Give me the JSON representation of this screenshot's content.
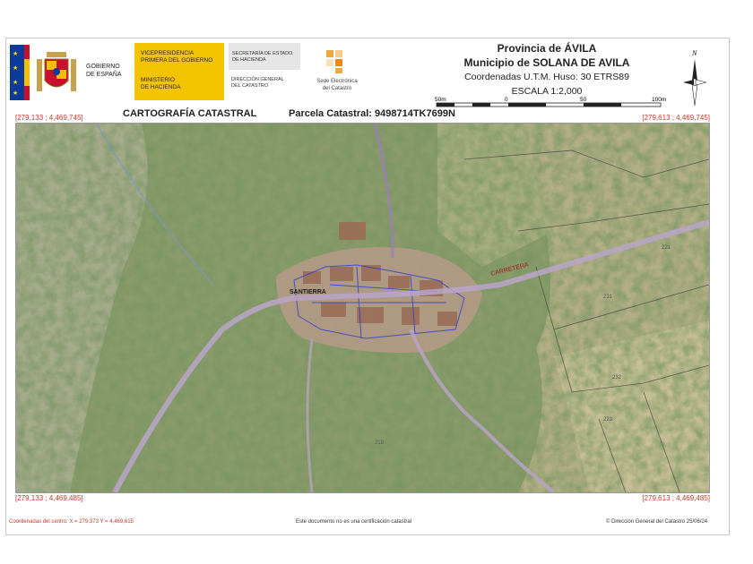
{
  "header": {
    "gob_text": "GOBIERNO\nDE ESPAÑA",
    "vice_text": "VICEPRESIDENCIA\nPRIMERA DEL GOBIERNO",
    "ministerio_text": "MINISTERIO\nDE HACIENDA",
    "secretaria_text": "SECRETARÍA DE ESTADO\nDE HACIENDA",
    "direccion_text": "DIRECCIÓN GENERAL\nDEL CATASTRO",
    "sede_text": "Sede Electrónica\ndel Catastro",
    "provincia": "Provincia de ÁVILA",
    "municipio": "Municipio de SOLANA DE AVILA",
    "utm": "Coordenadas U.T.M. Huso: 30 ETRS89",
    "escala": "ESCALA 1:2,000",
    "scale_labels": [
      "50m",
      "0",
      "50",
      "100m"
    ],
    "north_label": "N"
  },
  "titles": {
    "left": "CARTOGRAFÍA CATASTRAL",
    "right": "Parcela Catastral: 9498714TK7699N"
  },
  "corners": {
    "top_left": "[279,133 ; 4,469,745]",
    "top_right": "[279,613 ; 4,469,745]",
    "bottom_left": "[279,133 ; 4,469,485]",
    "bottom_right": "[279,613 ; 4,469,485]"
  },
  "map": {
    "road_label": "CARRETERA",
    "town_label": "SANTIERRA",
    "parcel_numbers": [
      "232",
      "223",
      "231",
      "219",
      "221"
    ]
  },
  "footer": {
    "center_coords": "Coordenadas del centro: X = 279,373 Y = 4,469,615",
    "disclaimer": "Este documento no es una certificación catastral",
    "copyright": "© Dirección General del Catastro 25/06/24"
  },
  "colors": {
    "flag_red": "#c8102e",
    "flag_yellow": "#f1bf00",
    "ministry_gold": "#f4c400",
    "coord_red": "#c0392b",
    "parcel_blue": "#2a3bd6",
    "road": "#b9a4c9"
  }
}
